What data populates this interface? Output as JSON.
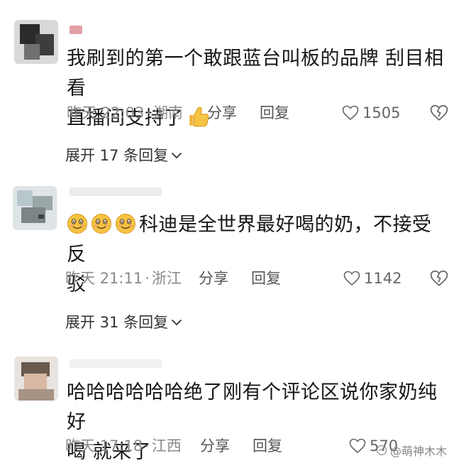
{
  "comments": [
    {
      "text_line1": "我刷到的第一个敢跟蓝台叫板的品牌 刮目相看",
      "text_line2": "直播间支持了",
      "emoji_trailing": "thumbs-up-icon",
      "time": "昨天 22:03",
      "location": "湖南",
      "share_label": "分享",
      "reply_label": "回复",
      "likes": "1505",
      "expand_label": "展开 17 条回复"
    },
    {
      "emoji_leading": [
        "smiling-face-icon",
        "smiling-face-icon",
        "smiling-face-icon"
      ],
      "text_line1": "科迪是全世界最好喝的奶，不接受反",
      "text_line2": "驳",
      "time": "昨天 21:11",
      "location": "浙江",
      "share_label": "分享",
      "reply_label": "回复",
      "likes": "1142",
      "expand_label": "展开 31 条回复"
    },
    {
      "text_line1": "哈哈哈哈哈哈绝了刚有个评论区说你家奶纯好",
      "text_line2": "喝 就来了",
      "time": "昨天 17:18",
      "location": "江西",
      "share_label": "分享",
      "reply_label": "回复",
      "likes": "570"
    }
  ],
  "separator": "·",
  "watermark": "@萌神木木",
  "colors": {
    "meta_text": "#8a8a8a",
    "emoji_yellow": "#f6c343"
  }
}
